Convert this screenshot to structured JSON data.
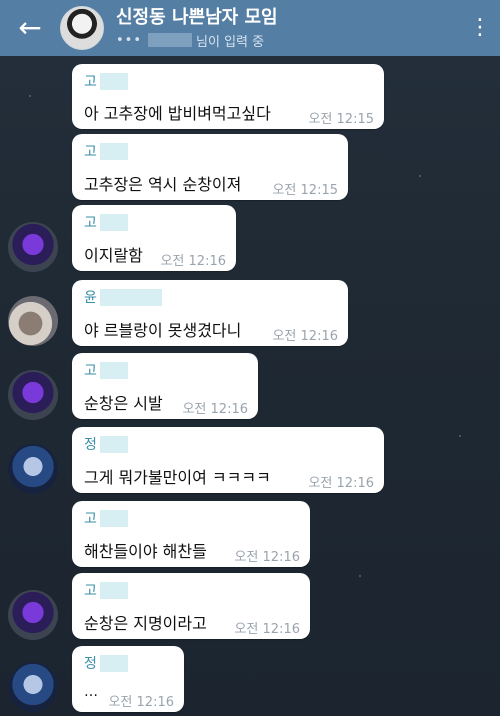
{
  "header": {
    "title": "신정동 나쁜남자 모임",
    "typing_dots": "•••",
    "typing_text": "님이 입력 중"
  },
  "messages": [
    {
      "name": "고",
      "text": "아 고추장에 밥비벼먹고싶다",
      "time": "오전 12:15"
    },
    {
      "name": "고",
      "text": "고추장은 역시 순창이져",
      "time": "오전 12:15"
    },
    {
      "name": "고",
      "text": "이지랄함",
      "time": "오전 12:16"
    },
    {
      "name": "윤",
      "text": "야 르블랑이 못생겼다니",
      "time": "오전 12:16"
    },
    {
      "name": "고",
      "text": "순창은 시발",
      "time": "오전 12:16"
    },
    {
      "name": "정",
      "text": "그게 뭐가불만이여 ㅋㅋㅋㅋ",
      "time": "오전 12:16"
    },
    {
      "name": "고",
      "text": "해찬들이야 해찬들",
      "time": "오전 12:16"
    },
    {
      "name": "고",
      "text": "순창은 지명이라고",
      "time": "오전 12:16"
    },
    {
      "name": "정",
      "text": "…",
      "time": "오전 12:16"
    }
  ],
  "icons": {
    "back": "←",
    "menu": "⋮"
  },
  "colors": {
    "header_bg": "#547ea3",
    "name_color": "#3a8ea8",
    "time_color": "#9aa4ad"
  }
}
